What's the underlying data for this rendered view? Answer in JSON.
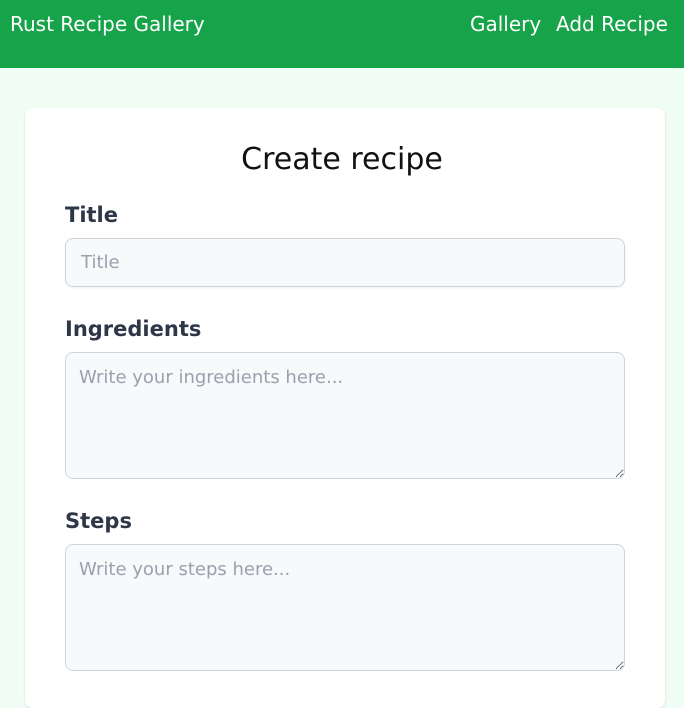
{
  "nav": {
    "brand": "Rust Recipe Gallery",
    "links": [
      "Gallery",
      "Add Recipe"
    ]
  },
  "form": {
    "heading": "Create recipe",
    "title_label": "Title",
    "title_placeholder": "Title",
    "ingredients_label": "Ingredients",
    "ingredients_placeholder": "Write your ingredients here...",
    "steps_label": "Steps",
    "steps_placeholder": "Write your steps here..."
  },
  "colors": {
    "navbar": "#16a34a",
    "page_background": "#f0fdf4",
    "card": "#ffffff",
    "label_text": "#2d3748"
  }
}
